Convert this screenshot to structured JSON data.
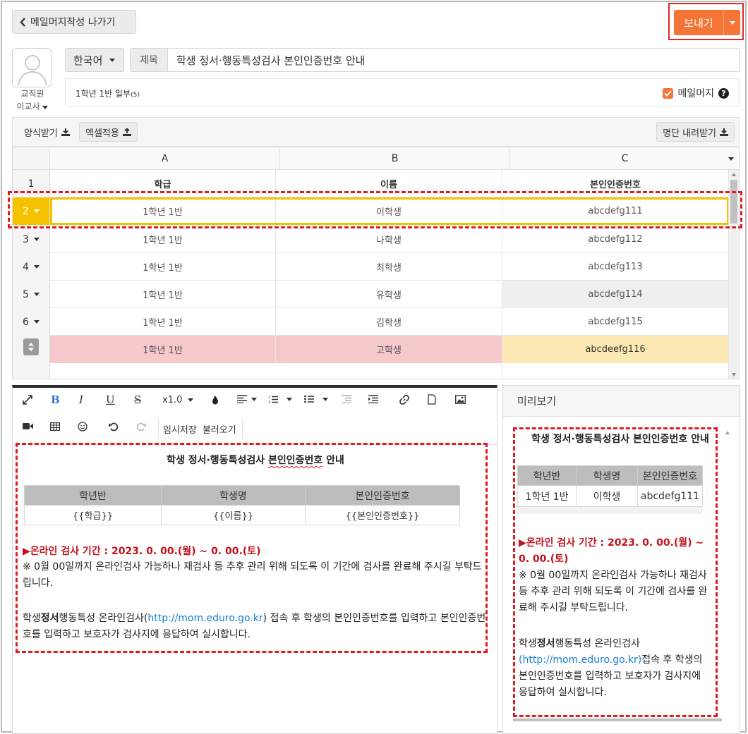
{
  "header": {
    "back_label": "메일머지작성 나가기",
    "send_label": "보내기"
  },
  "sender": {
    "role": "교직원",
    "name": "이교사"
  },
  "compose": {
    "language": "한국어",
    "subject_label": "제목",
    "subject_value": "학생 정서·행동특성검사 본인인증번호 안내",
    "recipients": "1학년 1반 일부",
    "recipients_count": "(5)",
    "mailmerge_label": "메일머지",
    "mailmerge_checked": true
  },
  "grid_toolbar": {
    "template_download": "양식받기",
    "excel_apply": "엑셀적용",
    "list_download": "명단 내려받기"
  },
  "grid": {
    "columns": [
      "A",
      "B",
      "C"
    ],
    "header_row": {
      "num": "1",
      "cells": [
        "학급",
        "이름",
        "본인인증번호"
      ]
    },
    "rows": [
      {
        "num": "2",
        "cells": [
          "1학년 1반",
          "이학생",
          "abcdefg111"
        ]
      },
      {
        "num": "3",
        "cells": [
          "1학년 1반",
          "나학생",
          "abcdefg112"
        ]
      },
      {
        "num": "4",
        "cells": [
          "1학년 1반",
          "최학생",
          "abcdefg113"
        ]
      },
      {
        "num": "5",
        "cells": [
          "1학년 1반",
          "유학생",
          "abcdefg114"
        ]
      },
      {
        "num": "6",
        "cells": [
          "1학년 1반",
          "김학생",
          "abcdefg115"
        ]
      },
      {
        "num": "",
        "cells": [
          "1학년 1반",
          "고학생",
          "abcdeefg116"
        ]
      }
    ],
    "selected_row": "2",
    "colors": {
      "selected": "#f5c200",
      "invalid_row": "#f6c9cc",
      "warn_cell": "#fde9b3",
      "row_gray": "#efefef"
    }
  },
  "editor": {
    "zoom": "x1.0",
    "temp_save": "임시저장",
    "load": "불러오기",
    "title_part1": "학생 정서·행동특성검사 ",
    "title_part2": "본인인증번호",
    "title_part3": " 안내",
    "table_headers": [
      "학년반",
      "학생명",
      "본인인증번호"
    ],
    "table_values": [
      "{{학급}}",
      "{{이름}}",
      "{{본인인증번호}}"
    ],
    "period": "▶온라인 검사 기간 : 2023. 0. 00.(월) ~ 0. 00.(토)",
    "note": "※ 0월 00일까지 온라인검사 가능하나 재검사 등 추후 관리 위해 되도록 이 기간에 검사를 완료해 주시길 부탁드립니다.",
    "body_a": "학생",
    "body_bold": "정서",
    "body_b": "행동특성 온라인검사(",
    "body_link": "http://mom.eduro.go.kr",
    "body_c": ") 접속 후 학생의 본인인증번호를 입력하고 본인인증번호를 입력하고 보호자가 검사지에 응답하여 실시합니다."
  },
  "preview": {
    "header": "미리보기",
    "title": "학생 정서·행동특성검사 본인인증번호 안내",
    "table_headers": [
      "학년반",
      "학생명",
      "본인인증번호"
    ],
    "table_values": [
      "1학년 1반",
      "이학생",
      "abcdefg111"
    ],
    "period": "▶온라인 검사 기간 : 2023. 0. 00.(월) ~ 0. 00.(토)",
    "note": "※ 0월 00일까지 온라인검사 가능하나 재검사 등 추후 관리 위해 되도록 이 기간에 검사를 완료해 주시길 부탁드립니다.",
    "body_a": "학생",
    "body_bold": "정서",
    "body_b": "행동특성 온라인검사",
    "body_link": "(http://mom.eduro.go.kr)",
    "body_c": "접속 후 학생의 본인인증번호를 입력하고 보호자가 검사지에 응답하여 실시합니다."
  },
  "colors": {
    "accent": "#f47536",
    "highlight_border": "#e11b22",
    "link": "#1a7fd4"
  }
}
